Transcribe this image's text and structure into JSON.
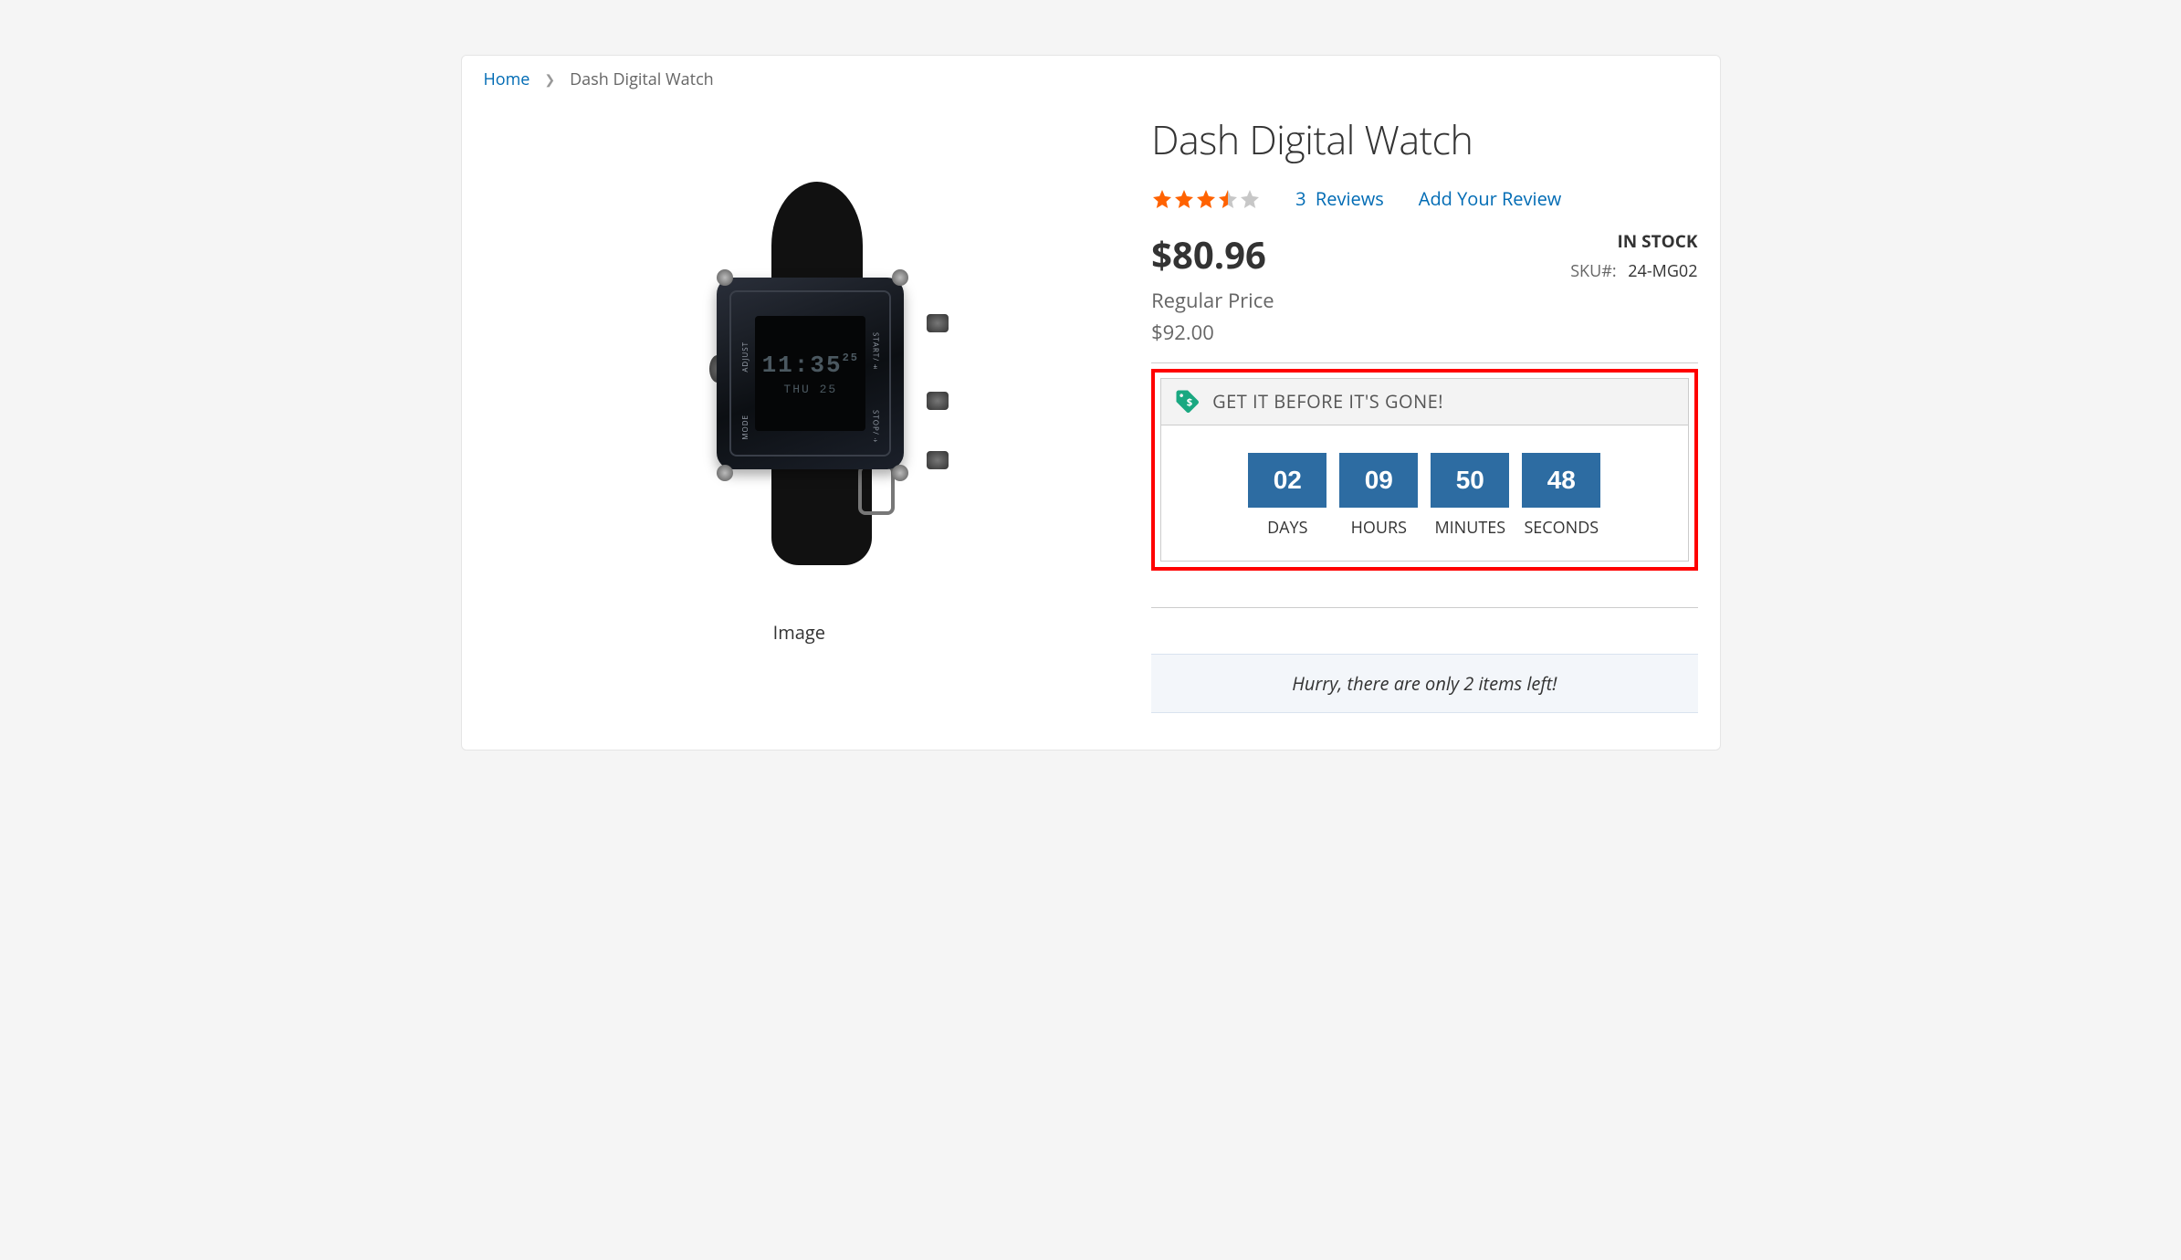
{
  "breadcrumb": {
    "home": "Home",
    "current": "Dash Digital Watch"
  },
  "product": {
    "title": "Dash Digital Watch",
    "rating": 3.5,
    "reviews_count": "3",
    "reviews_label": "Reviews",
    "add_review": "Add Your Review",
    "price": "$80.96",
    "regular_label": "Regular Price",
    "old_price": "$92.00",
    "stock_status": "IN STOCK",
    "sku_label": "SKU#:",
    "sku_value": "24-MG02",
    "image_label": "Image",
    "watch_display": {
      "time_main": "11:35",
      "time_sec": "25",
      "date": "THU 25",
      "side_labels": [
        "ADJUST",
        "MODE",
        "START/±",
        "STOP/÷"
      ]
    }
  },
  "countdown": {
    "header": "GET IT BEFORE IT'S GONE!",
    "units": [
      {
        "value": "02",
        "label": "DAYS"
      },
      {
        "value": "09",
        "label": "HOURS"
      },
      {
        "value": "50",
        "label": "MINUTES"
      },
      {
        "value": "48",
        "label": "SECONDS"
      }
    ]
  },
  "hurry_message": "Hurry, there are only 2 items left!"
}
